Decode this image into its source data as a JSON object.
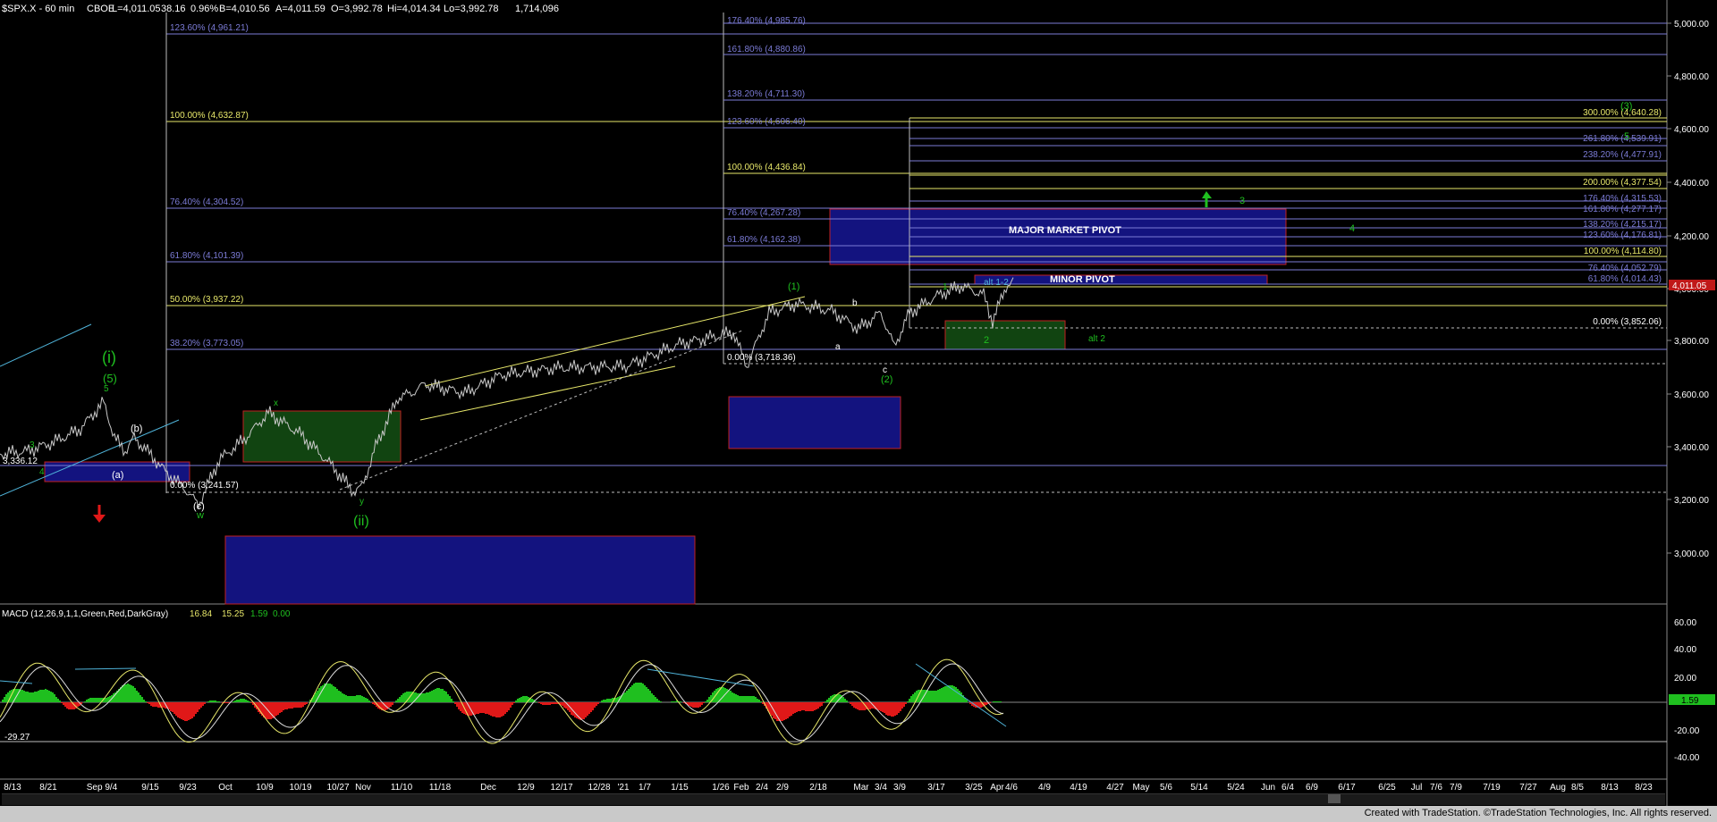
{
  "header": {
    "symbol": "$SPX.X - 60 min",
    "exchange": "CBOE",
    "last": "L=4,011.05",
    "change": "38.16",
    "pct": "0.96%",
    "bid": "B=4,010.56",
    "ask": "A=4,011.59",
    "open": "O=3,992.78",
    "high": "Hi=4,014.34",
    "low": "Lo=3,992.78",
    "volume": "1,714,096"
  },
  "macd_header": {
    "label": "MACD (12,26,9,1,1,Green,Red,DarkGray)",
    "v1": "16.84",
    "v2": "15.25",
    "v3": "1.59",
    "v4": "0.00"
  },
  "price_axis": {
    "ticks": [
      "5,000.00",
      "4,800.00",
      "4,600.00",
      "4,400.00",
      "4,200.00",
      "4,000.00",
      "3,800.00",
      "3,600.00",
      "3,400.00",
      "3,200.00",
      "3,000.00"
    ],
    "current": "4,011.05"
  },
  "macd_axis": {
    "ticks": [
      "60.00",
      "40.00",
      "20.00",
      "-20.00",
      "-40.00"
    ],
    "current": "1.59",
    "left_label": "-29.27"
  },
  "left_label": "3,336.12",
  "date_axis": [
    "8/13",
    "8/21",
    "Sep 9/4",
    "9/15",
    "9/23",
    "Oct",
    "10/9",
    "10/19",
    "10/27",
    "Nov",
    "11/10",
    "11/18",
    "Dec",
    "12/9",
    "12/17",
    "12/28",
    "'21",
    "1/7",
    "1/15",
    "1/26",
    "Feb",
    "2/4",
    "2/9",
    "2/18",
    "Mar",
    "3/4",
    "3/9",
    "3/17",
    "3/25",
    "Apr",
    "4/6",
    "4/9",
    "4/19",
    "4/27",
    "May",
    "5/6",
    "5/14",
    "5/24",
    "Jun",
    "6/4",
    "6/9",
    "6/17",
    "6/25",
    "Jul",
    "7/6",
    "7/9",
    "7/19",
    "7/27",
    "Aug",
    "8/5",
    "8/13",
    "8/23"
  ],
  "fib_left": [
    "123.60% (4,961.21)",
    "100.00% (4,632.87)",
    "76.40% (4,304.52)",
    "61.80% (4,101.39)",
    "50.00% (3,937.22)",
    "38.20% (3,773.05)",
    "0.00% (3,241.57)"
  ],
  "fib_mid": [
    "176.40% (4,985.76)",
    "161.80% (4,880.86)",
    "138.20% (4,711.30)",
    "123.60% (4,606.40)",
    "100.00% (4,436.84)",
    "76.40% (4,267.28)",
    "61.80% (4,162.38)",
    "0.00% (3,718.36)"
  ],
  "fib_right": [
    "300.00% (4,640.28)",
    "261.80% (4,539.91)",
    "238.20% (4,477.91)",
    "200.00% (4,377.54)",
    "176.40% (4,315.53)",
    "161.80% (4,277.17)",
    "138.20% (4,215.17)",
    "123.60% (4,176.81)",
    "100.00% (4,114.80)",
    "76.40% (4,052.79)",
    "61.80% (4,014.43)",
    "0.00% (3,852.06)"
  ],
  "annotations": {
    "major_pivot": "MAJOR MARKET PIVOT",
    "minor_pivot": "MINOR PIVOT",
    "alt2": "alt 2",
    "alt12": "alt 1-2",
    "w_i": "(i)",
    "w_5p": "(5)",
    "w_5": "5",
    "w_3": "3",
    "w_4": "4",
    "w_b": "(b)",
    "w_a": "(a)",
    "w_c": "(c)",
    "w_w": "w",
    "w_x": "x",
    "w_y": "y",
    "w_ii": "(ii)",
    "w_1p": "(1)",
    "w_bb": "b",
    "w_aa": "a",
    "w_cc": "c",
    "w_2p": "(2)",
    "w_1": "1",
    "w_2": "2",
    "w_3r": "3",
    "w_4r": "4",
    "w_3p": "(3)",
    "w_5r": "5"
  },
  "colors": {
    "fib_blue": "#7b7bd6",
    "fib_yellow": "#e8e86a",
    "green": "#1fbf1f",
    "red": "#e01818",
    "pivot_fill": "#13137f"
  },
  "footer": "Created with TradeStation. ©TradeStation Technologies, Inc. All rights reserved."
}
